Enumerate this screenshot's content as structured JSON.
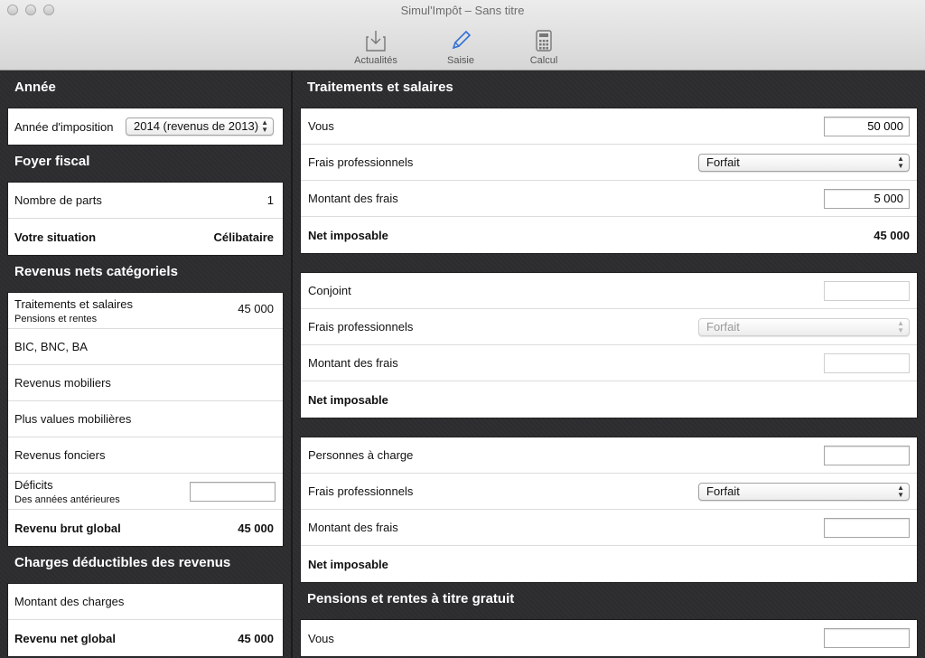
{
  "window": {
    "title": "Simul'Impôt – Sans titre"
  },
  "toolbar": {
    "items": [
      {
        "label": "Actualités",
        "icon": "download-icon"
      },
      {
        "label": "Saisie",
        "icon": "pencil-icon"
      },
      {
        "label": "Calcul",
        "icon": "calculator-icon"
      }
    ]
  },
  "left": {
    "annee": {
      "title": "Année",
      "row_label": "Année d'imposition",
      "select_value": "2014 (revenus de 2013)"
    },
    "foyer": {
      "title": "Foyer fiscal",
      "parts_label": "Nombre de parts",
      "parts_value": "1",
      "situation_label": "Votre situation",
      "situation_value": "Célibataire"
    },
    "revenus": {
      "title": "Revenus nets catégoriels",
      "traitements_label": "Traitements et salaires",
      "traitements_sub": "Pensions et rentes",
      "traitements_value": "45 000",
      "bic_label": "BIC, BNC, BA",
      "mobiliers_label": "Revenus mobiliers",
      "plus_values_label": "Plus values mobilières",
      "fonciers_label": "Revenus fonciers",
      "deficits_label": "Déficits",
      "deficits_sub": "Des années antérieures",
      "deficits_value": "",
      "brut_label": "Revenu brut global",
      "brut_value": "45 000"
    },
    "charges": {
      "title": "Charges déductibles des revenus",
      "montant_label": "Montant des charges",
      "net_label": "Revenu net global",
      "net_value": "45 000"
    }
  },
  "right": {
    "traitements": {
      "title": "Traitements et salaires",
      "vous": {
        "label": "Vous",
        "value": "50 000"
      },
      "frais": {
        "label": "Frais professionnels",
        "select": "Forfait"
      },
      "montant": {
        "label": "Montant des frais",
        "value": "5 000"
      },
      "net": {
        "label": "Net imposable",
        "value": "45 000"
      }
    },
    "conjoint": {
      "who": {
        "label": "Conjoint",
        "value": ""
      },
      "frais": {
        "label": "Frais professionnels",
        "select": "Forfait"
      },
      "montant": {
        "label": "Montant des frais",
        "value": ""
      },
      "net": {
        "label": "Net imposable",
        "value": ""
      }
    },
    "charge": {
      "who": {
        "label": "Personnes à charge",
        "value": ""
      },
      "frais": {
        "label": "Frais professionnels",
        "select": "Forfait"
      },
      "montant": {
        "label": "Montant des frais",
        "value": ""
      },
      "net": {
        "label": "Net imposable",
        "value": ""
      }
    },
    "pensions": {
      "title": "Pensions et rentes à titre gratuit",
      "vous": {
        "label": "Vous",
        "value": ""
      }
    }
  }
}
